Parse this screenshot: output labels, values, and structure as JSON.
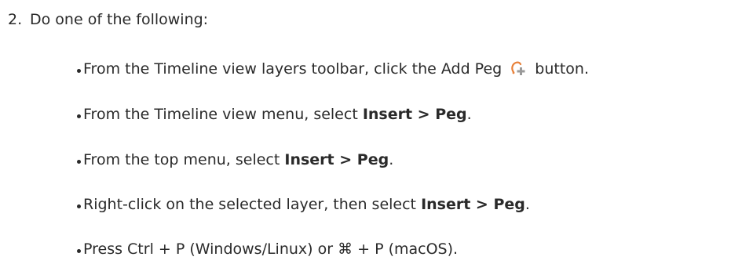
{
  "step": {
    "number": "2.",
    "heading": "Do one of the following:"
  },
  "bullets": [
    {
      "before": "From the Timeline view layers toolbar, click the Add Peg ",
      "icon": "add-peg-icon",
      "after": " button."
    },
    {
      "before": "From the Timeline view menu, select ",
      "bold": "Insert > Peg",
      "after": "."
    },
    {
      "before": "From the top menu, select ",
      "bold": "Insert > Peg",
      "after": "."
    },
    {
      "before": "Right-click on the selected layer, then select ",
      "bold": "Insert > Peg",
      "after": "."
    },
    {
      "text": "Press Ctrl + P (Windows/Linux) or ⌘ + P (macOS)."
    }
  ],
  "colors": {
    "text": "#2a2a2a",
    "icon_orange": "#e8813a",
    "icon_gray": "#9a9a9a"
  }
}
